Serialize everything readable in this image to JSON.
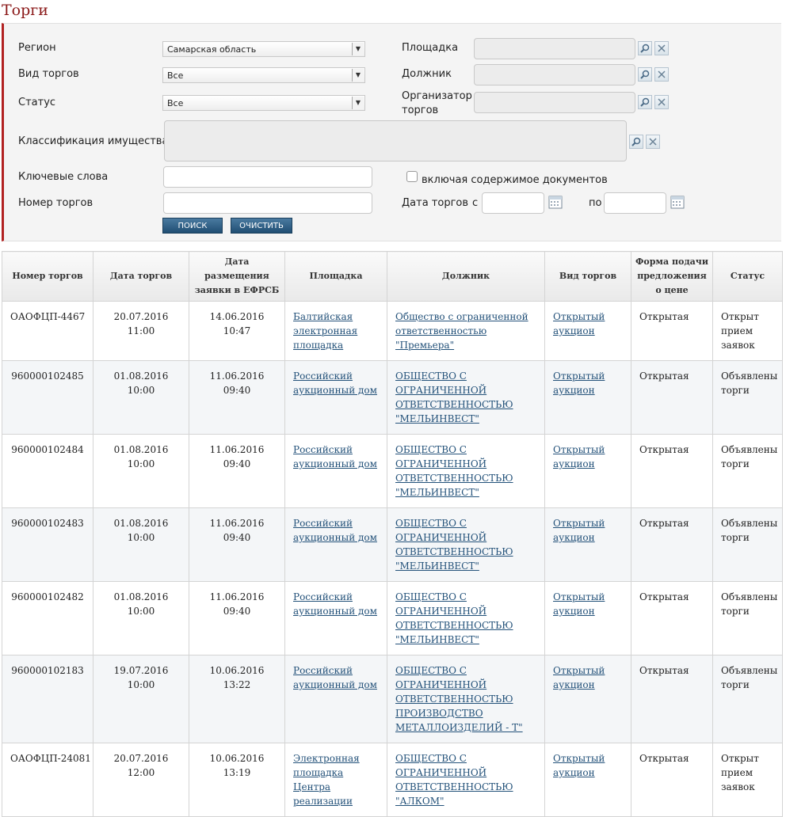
{
  "title": "Торги",
  "filters": {
    "region_label": "Регион",
    "region_value": "Самарская область",
    "type_label": "Вид торгов",
    "type_value": "Все",
    "status_label": "Статус",
    "status_value": "Все",
    "platform_label": "Площадка",
    "debtor_label": "Должник",
    "organizer_label_line1": "Организатор",
    "organizer_label_line2": "торгов",
    "classification_label": "Классификация имущества",
    "keywords_label": "Ключевые слова",
    "include_docs_label": "включая содержимое документов",
    "number_label": "Номер торгов",
    "date_label": "Дата торгов",
    "date_from_label": "с",
    "date_to_label": "по",
    "search_button": "ПОИСК",
    "clear_button": "ОЧИСТИТЬ"
  },
  "table": {
    "headers": [
      "Номер торгов",
      "Дата торгов",
      "Дата размещения заявки в ЕФРСБ",
      "Площадка",
      "Должник",
      "Вид торгов",
      "Форма подачи предложения о цене",
      "Статус"
    ],
    "rows": [
      {
        "number": "ОАОФЦП-4467",
        "date": "20.07.2016 11:00",
        "posted": "14.06.2016 10:47",
        "platform": "Балтийская электронная площадка",
        "debtor": "Общество с ограниченной ответственностью \"Премьера\"",
        "type": "Открытый аукцион",
        "form": "Открытая",
        "status": "Открыт прием заявок"
      },
      {
        "number": "960000102485",
        "date": "01.08.2016 10:00",
        "posted": "11.06.2016 09:40",
        "platform": "Российский аукционный дом",
        "debtor": "ОБЩЕСТВО С ОГРАНИЧЕННОЙ ОТВЕТСТВЕННОСТЬЮ \"МЕЛЬИНВЕСТ\"",
        "type": "Открытый аукцион",
        "form": "Открытая",
        "status": "Объявлены торги"
      },
      {
        "number": "960000102484",
        "date": "01.08.2016 10:00",
        "posted": "11.06.2016 09:40",
        "platform": "Российский аукционный дом",
        "debtor": "ОБЩЕСТВО С ОГРАНИЧЕННОЙ ОТВЕТСТВЕННОСТЬЮ \"МЕЛЬИНВЕСТ\"",
        "type": "Открытый аукцион",
        "form": "Открытая",
        "status": "Объявлены торги"
      },
      {
        "number": "960000102483",
        "date": "01.08.2016 10:00",
        "posted": "11.06.2016 09:40",
        "platform": "Российский аукционный дом",
        "debtor": "ОБЩЕСТВО С ОГРАНИЧЕННОЙ ОТВЕТСТВЕННОСТЬЮ \"МЕЛЬИНВЕСТ\"",
        "type": "Открытый аукцион",
        "form": "Открытая",
        "status": "Объявлены торги"
      },
      {
        "number": "960000102482",
        "date": "01.08.2016 10:00",
        "posted": "11.06.2016 09:40",
        "platform": "Российский аукционный дом",
        "debtor": "ОБЩЕСТВО С ОГРАНИЧЕННОЙ ОТВЕТСТВЕННОСТЬЮ \"МЕЛЬИНВЕСТ\"",
        "type": "Открытый аукцион",
        "form": "Открытая",
        "status": "Объявлены торги"
      },
      {
        "number": "960000102183",
        "date": "19.07.2016 10:00",
        "posted": "10.06.2016 13:22",
        "platform": "Российский аукционный дом",
        "debtor": "ОБЩЕСТВО С ОГРАНИЧЕННОЙ ОТВЕТСТВЕННОСТЬЮ ПРОИЗВОДСТВО МЕТАЛЛОИЗДЕЛИЙ - Т\"",
        "type": "Открытый аукцион",
        "form": "Открытая",
        "status": "Объявлены торги"
      },
      {
        "number": "ОАОФЦП-24081",
        "date": "20.07.2016 12:00",
        "posted": "10.06.2016 13:19",
        "platform": "Электронная площадка Центра реализации",
        "debtor": "ОБЩЕСТВО С ОГРАНИЧЕННОЙ ОТВЕТСТВЕННОСТЬЮ \"АЛКОМ\"",
        "type": "Открытый аукцион",
        "form": "Открытая",
        "status": "Открыт прием заявок"
      }
    ]
  }
}
